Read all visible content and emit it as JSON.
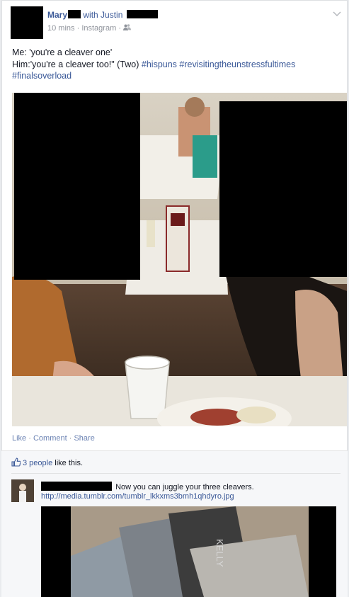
{
  "post": {
    "author": "Mary",
    "with_prefix": "with",
    "tagged_name": "Justin",
    "time_ago": "10 mins",
    "source": "Instagram",
    "separator": "·",
    "line1": "Me: 'you're a cleaver one'",
    "line2_text": "Him:'you're a cleaver too!\" (Two) ",
    "hashtags_line2": "#hispuns #revisitingtheunstressfultimes",
    "hashtag_line3": "#finalsoverload"
  },
  "actions": {
    "like": "Like",
    "comment": "Comment",
    "share": "Share",
    "sep": "·"
  },
  "ufi": {
    "likes_count": "3 people",
    "likes_suffix": " like this."
  },
  "comment": {
    "text": "Now you can juggle your three cleavers.",
    "link": "http://media.tumblr.com/tumblr_lkkxms3bmh1qhdyro.jpg",
    "image_text": "KELLY"
  },
  "icons": {
    "chevron": "chevron-down-icon",
    "audience": "friends-icon",
    "like": "thumbs-up-icon"
  },
  "colors": {
    "link_blue": "#3b5998",
    "meta_gray": "#90949c",
    "redaction": "#000000"
  }
}
